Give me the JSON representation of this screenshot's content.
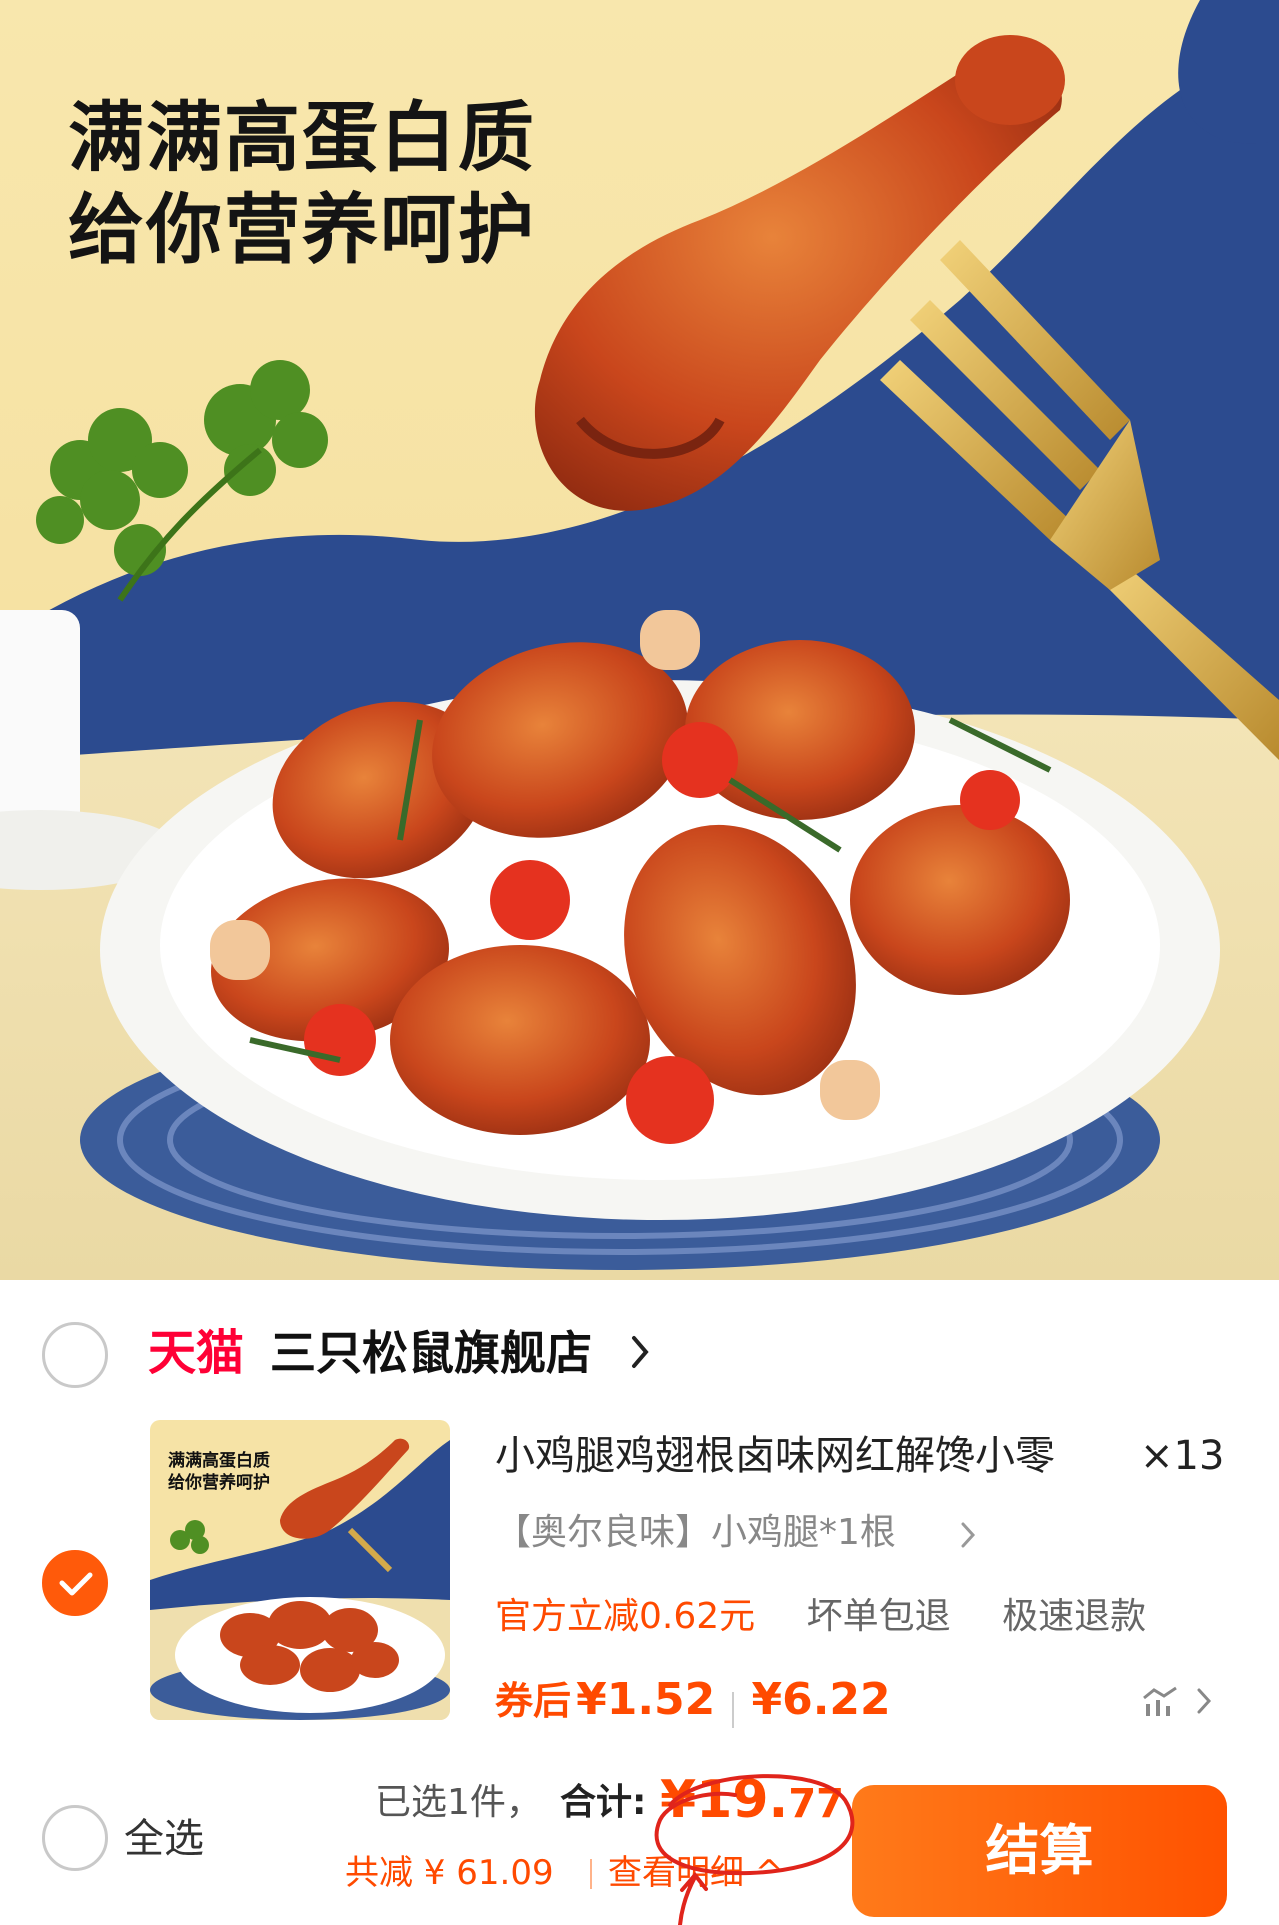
{
  "hero": {
    "headline_line1": "满满高蛋白质",
    "headline_line2": "给你营养呵护"
  },
  "store": {
    "platform_logo": "天猫",
    "name": "三只松鼠旗舰店",
    "selected": false
  },
  "item": {
    "selected": true,
    "thumbnail_text_line1": "满满高蛋白质",
    "thumbnail_text_line2": "给你营养呵护",
    "title": "小鸡腿鸡翅根卤味网红解馋小零",
    "quantity": "×13",
    "sku": "【奥尔良味】小鸡腿*1根",
    "promo_discount": "官方立减0.62元",
    "promo_tags": [
      "坏单包退",
      "极速退款"
    ],
    "coupon_label": "券后",
    "coupon_price": "¥1.52",
    "original_price": "¥6.22"
  },
  "footer": {
    "select_all_label": "全选",
    "selected_count": "已选1件，",
    "total_label": "合计:",
    "total_main": "¥19.",
    "total_cents": "77",
    "saved_text": "共减 ¥ 61.09",
    "detail_link": "查看明细 ^",
    "checkout_label": "结算"
  },
  "colors": {
    "accent": "#ff5a0a",
    "price": "#ff4a00",
    "tmall": "#ff0036",
    "hero_yellow": "#f7e2a0",
    "hero_blue": "#2c4b8f"
  },
  "icons": [
    "chevron-right-icon",
    "check-icon",
    "price-trend-icon",
    "hand-drawn-circle-annotation",
    "hand-drawn-arrow-annotation"
  ]
}
